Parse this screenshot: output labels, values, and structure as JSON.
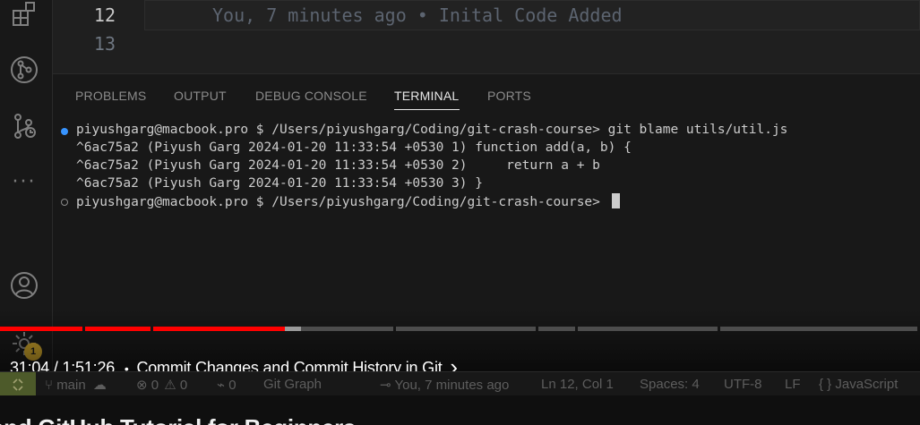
{
  "editor": {
    "lines": [
      {
        "number": "12",
        "blame": "You, 7 minutes ago • Inital Code Added"
      },
      {
        "number": "13"
      }
    ]
  },
  "panel": {
    "tabs": [
      {
        "label": "PROBLEMS",
        "active": false
      },
      {
        "label": "OUTPUT",
        "active": false
      },
      {
        "label": "DEBUG CONSOLE",
        "active": false
      },
      {
        "label": "TERMINAL",
        "active": true
      },
      {
        "label": "PORTS",
        "active": false
      }
    ]
  },
  "terminal": {
    "lines": [
      "piyushgarg@macbook.pro $ /Users/piyushgarg/Coding/git-crash-course> git blame utils/util.js",
      "^6ac75a2 (Piyush Garg 2024-01-20 11:33:54 +0530 1) function add(a, b) {",
      "^6ac75a2 (Piyush Garg 2024-01-20 11:33:54 +0530 2)     return a + b",
      "^6ac75a2 (Piyush Garg 2024-01-20 11:33:54 +0530 3) }",
      "piyushgarg@macbook.pro $ /Users/piyushgarg/Coding/git-crash-course> "
    ]
  },
  "activity_bar": {
    "icons": [
      "extensions-icon",
      "source-control-icon",
      "git-graph-icon",
      "more-icon",
      "account-icon",
      "settings-icon"
    ],
    "badge": "1"
  },
  "video": {
    "time": "31:04 / 1:51:26",
    "separator": "•",
    "chapter": "Commit Changes and Commit History in Git",
    "chevron": "›",
    "progress_played": 0.31,
    "progress_buffered": 0.327
  },
  "status_bar": {
    "branch": "main",
    "errors": "0",
    "warnings": "0",
    "ports": "0",
    "git_graph": "Git Graph",
    "blame": "You, 7 minutes ago",
    "position": "Ln 12, Col 1",
    "spaces": "Spaces: 4",
    "encoding": "UTF-8",
    "eol": "LF",
    "language": "JavaScript",
    "language_icon": "{ }"
  },
  "page": {
    "title_partial": "and GitHub Tutorial for Beginners"
  },
  "colors": {
    "progress_played": "#ff0000",
    "progress_buffered": "#9a9a9a",
    "progress_track": "#4d4d4d",
    "terminal_dot": "#3794ff"
  }
}
